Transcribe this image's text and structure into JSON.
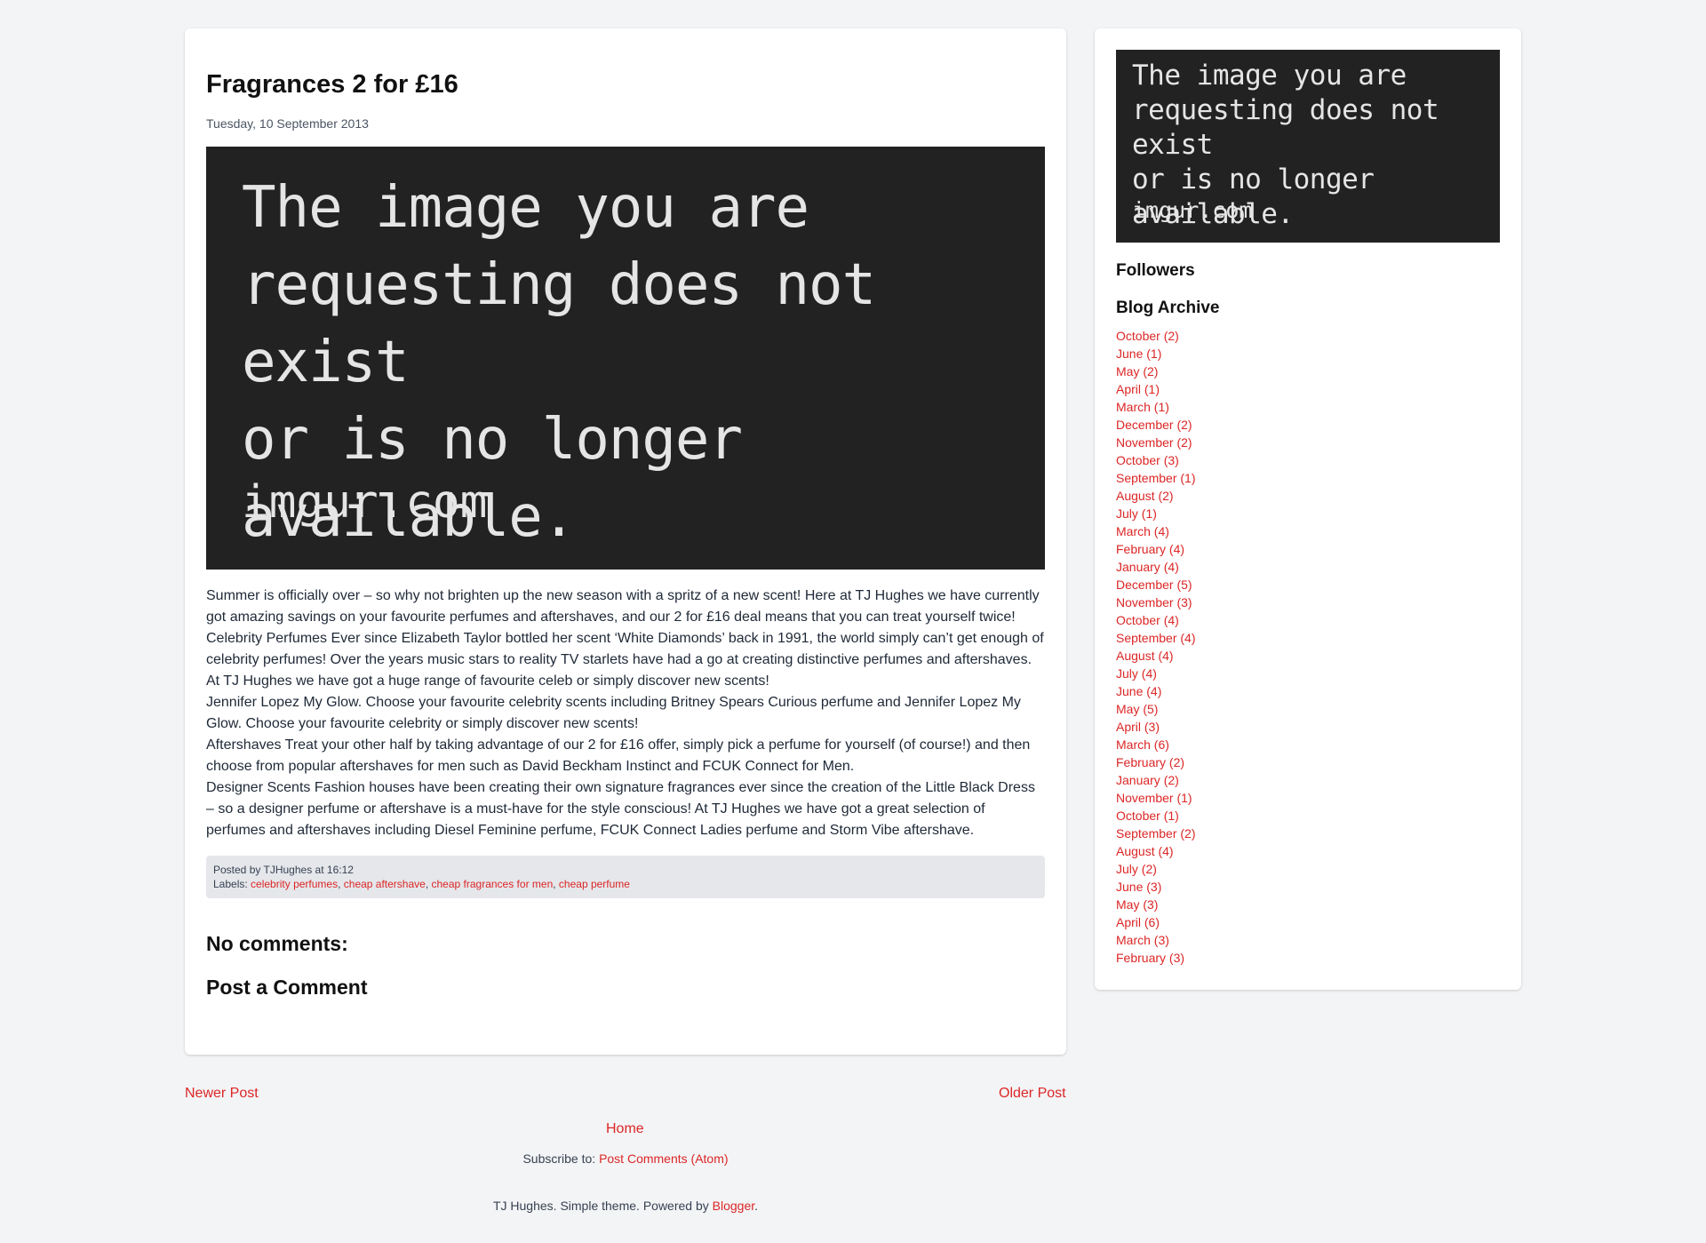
{
  "post": {
    "title": "Fragrances 2 for £16",
    "date": "Tuesday, 10 September 2013",
    "image": {
      "message": "The image you are\nrequesting does not exist\nor is no longer available.",
      "site": "imgur.com"
    },
    "paragraphs": [
      "Summer is officially over – so why not brighten up the new season with a spritz of a new scent! Here at TJ Hughes we have currently got amazing savings on your favourite perfumes and aftershaves, and our 2 for £16 deal means that you can treat yourself twice!",
      "Celebrity Perfumes Ever since Elizabeth Taylor bottled her scent ‘White Diamonds’ back in 1991, the world simply can’t get enough of celebrity perfumes! Over the years music stars to reality TV starlets have had a go at creating distinctive perfumes and aftershaves.",
      "At TJ Hughes we have got a huge range of favourite celeb or simply discover new scents!",
      "Jennifer Lopez My Glow. Choose your favourite celebrity scents including Britney Spears Curious perfume and Jennifer Lopez My Glow. Choose your favourite celebrity or simply discover new scents!",
      "Aftershaves Treat your other half by taking advantage of our 2 for £16 offer, simply pick a perfume for yourself (of course!) and then choose from popular aftershaves for men such as David Beckham Instinct and FCUK Connect for Men.",
      "Designer Scents Fashion houses have been creating their own signature fragrances ever since the creation of the Little Black Dress – so a designer perfume or aftershave is a must-have for the style conscious! At TJ Hughes we have got a great selection of perfumes and aftershaves including Diesel Feminine perfume, FCUK Connect Ladies perfume and Storm Vibe aftershave."
    ],
    "footer": {
      "posted_by_prefix": "Posted by",
      "author": "TJHughes",
      "at_word": "at",
      "time": "16:12",
      "labels_prefix": "Labels:",
      "labels": [
        "celebrity perfumes",
        "cheap aftershave",
        "cheap fragrances for men",
        "cheap perfume"
      ]
    },
    "comments_heading": "No comments:",
    "post_comment_heading": "Post a Comment"
  },
  "sidebar": {
    "image": {
      "message": "The image you are\nrequesting does not exist\nor is no longer available.",
      "site": "imgur.com"
    },
    "followers_heading": "Followers",
    "archive_heading": "Blog Archive",
    "archive": [
      "October (2)",
      "June (1)",
      "May (2)",
      "April (1)",
      "March (1)",
      "December (2)",
      "November (2)",
      "October (3)",
      "September (1)",
      "August (2)",
      "July (1)",
      "March (4)",
      "February (4)",
      "January (4)",
      "December (5)",
      "November (3)",
      "October (4)",
      "September (4)",
      "August (4)",
      "July (4)",
      "June (4)",
      "May (5)",
      "April (3)",
      "March (6)",
      "February (2)",
      "January (2)",
      "November (1)",
      "October (1)",
      "September (2)",
      "August (4)",
      "July (2)",
      "June (3)",
      "May (3)",
      "April (6)",
      "March (3)",
      "February (3)"
    ]
  },
  "pager": {
    "newer": "Newer Post",
    "older": "Older Post",
    "home": "Home"
  },
  "subscribe": {
    "prefix": "Subscribe to:",
    "link": "Post Comments (Atom)"
  },
  "attribution": {
    "text": "TJ Hughes. Simple theme. Powered by",
    "link": "Blogger",
    "suffix": "."
  },
  "colors": {
    "background": "#f3f4f6",
    "link": "#dc2626",
    "card": "#ffffff",
    "image_bg": "#222222"
  }
}
